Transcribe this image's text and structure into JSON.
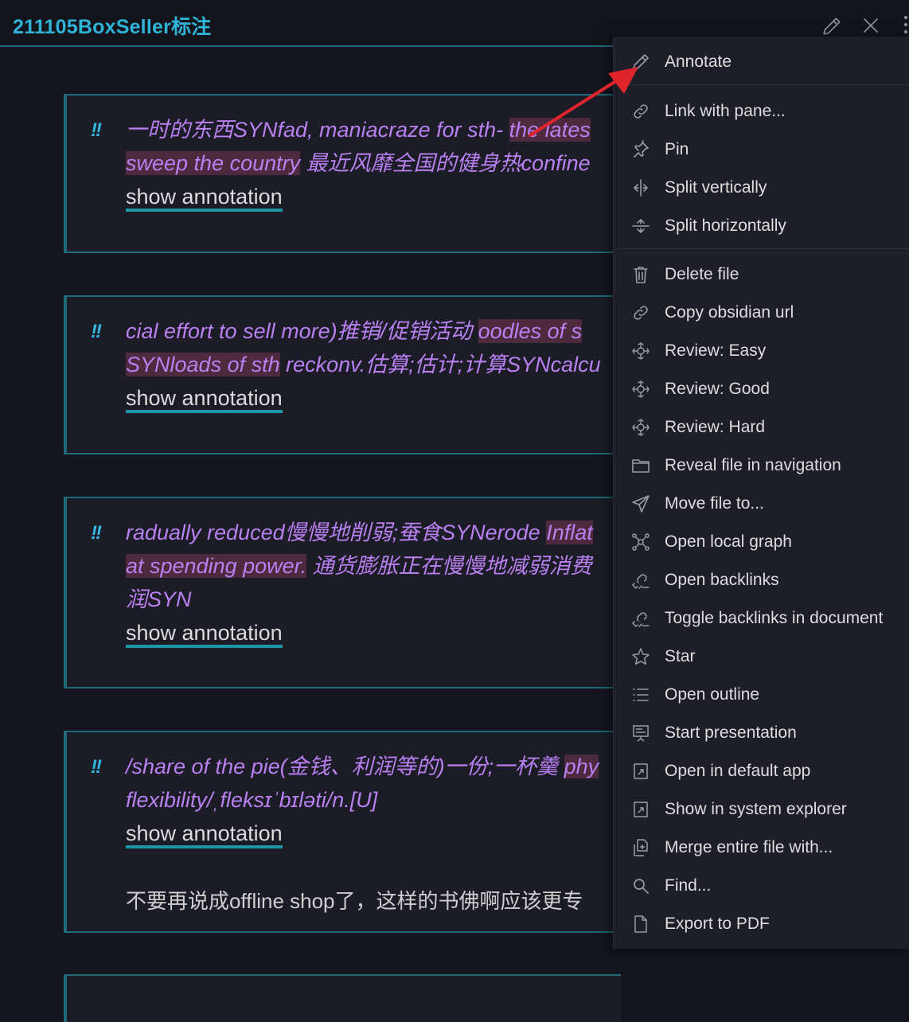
{
  "header": {
    "title": "211105BoxSeller标注"
  },
  "blocks": [
    {
      "marker": "!!",
      "lines": [
        [
          {
            "t": "一时的东西SYNfad, maniacraze for sth- ",
            "hl": false
          },
          {
            "t": "the lates",
            "hl": true
          }
        ],
        [
          {
            "t": "sweep the country",
            "hl": true
          },
          {
            "t": " 最近风靡全国的健身热confine",
            "hl": false
          }
        ]
      ],
      "show_annotation": "show annotation",
      "note": ""
    },
    {
      "marker": "!!",
      "lines": [
        [
          {
            "t": "cial effort to sell more)推销/促销活动 ",
            "hl": false
          },
          {
            "t": "oodles of s",
            "hl": true
          }
        ],
        [
          {
            "t": "SYNloads of sth",
            "hl": true
          },
          {
            "t": " reckonv.估算;估计;计算SYNcalcu",
            "hl": false
          }
        ]
      ],
      "show_annotation": "show annotation",
      "note": ""
    },
    {
      "marker": "!!",
      "lines": [
        [
          {
            "t": "radually reduced慢慢地削弱;蚕食SYNerode ",
            "hl": false
          },
          {
            "t": "Inflat",
            "hl": true
          }
        ],
        [
          {
            "t": "at spending power.",
            "hl": true
          },
          {
            "t": " 通货膨胀正在慢慢地减弱消费",
            "hl": false
          }
        ],
        [
          {
            "t": "润SYN",
            "hl": false
          }
        ]
      ],
      "show_annotation": "show annotation",
      "note": ""
    },
    {
      "marker": "!!",
      "lines": [
        [
          {
            "t": "/share of the pie(金钱、利润等的)一份;一杯羹 ",
            "hl": false
          },
          {
            "t": "phy",
            "hl": true
          }
        ],
        [
          {
            "t": "flexibility/ˌfleksɪˈbɪləti/n.[U]",
            "hl": false
          }
        ]
      ],
      "show_annotation": "show annotation",
      "note": "不要再说成offline shop了，这样的书佛啊应该更专"
    }
  ],
  "menu": {
    "items": [
      {
        "label": "Annotate",
        "icon": "pencil-icon"
      },
      {
        "label": "Link with pane...",
        "icon": "link-icon"
      },
      {
        "label": "Pin",
        "icon": "pin-icon"
      },
      {
        "label": "Split vertically",
        "icon": "split-vertical-icon"
      },
      {
        "label": "Split horizontally",
        "icon": "split-horizontal-icon"
      },
      {
        "label": "Delete file",
        "icon": "trash-icon"
      },
      {
        "label": "Copy obsidian url",
        "icon": "link-icon"
      },
      {
        "label": "Review: Easy",
        "icon": "review-icon"
      },
      {
        "label": "Review: Good",
        "icon": "review-icon"
      },
      {
        "label": "Review: Hard",
        "icon": "review-icon"
      },
      {
        "label": "Reveal file in navigation",
        "icon": "folder-icon"
      },
      {
        "label": "Move file to...",
        "icon": "send-icon"
      },
      {
        "label": "Open local graph",
        "icon": "graph-icon"
      },
      {
        "label": "Open backlinks",
        "icon": "backlinks-icon"
      },
      {
        "label": "Toggle backlinks in document",
        "icon": "backlinks-icon"
      },
      {
        "label": "Star",
        "icon": "star-icon"
      },
      {
        "label": "Open outline",
        "icon": "list-icon"
      },
      {
        "label": "Start presentation",
        "icon": "presentation-icon"
      },
      {
        "label": "Open in default app",
        "icon": "open-external-icon"
      },
      {
        "label": "Show in system explorer",
        "icon": "open-external-icon"
      },
      {
        "label": "Merge entire file with...",
        "icon": "merge-icon"
      },
      {
        "label": "Find...",
        "icon": "search-icon"
      },
      {
        "label": "Export to PDF",
        "icon": "document-icon"
      }
    ]
  },
  "colors": {
    "accent": "#2fb4d8",
    "quote_text": "#b880f0",
    "highlight": "#4d2a3d",
    "annotation_arrow": "#e0242c"
  }
}
